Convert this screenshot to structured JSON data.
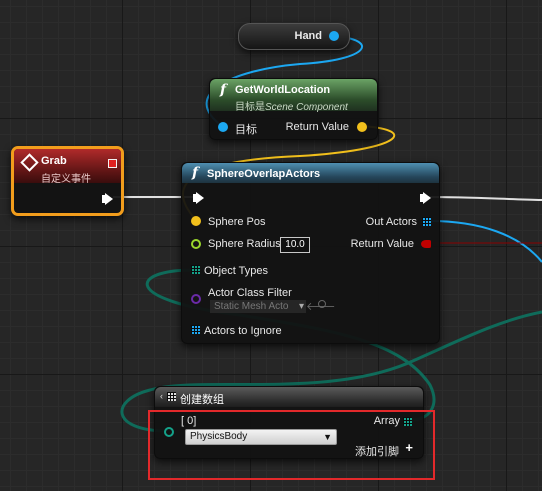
{
  "hand_node": {
    "label": "Hand"
  },
  "get_world_location": {
    "title": "GetWorldLocation",
    "subtitle_prefix": "目标是",
    "subtitle_class": "Scene Component",
    "in_pin": "目标",
    "out_pin": "Return Value"
  },
  "grab_event": {
    "title": "Grab",
    "subtitle": "自定义事件"
  },
  "sphere_overlap": {
    "title": "SphereOverlapActors",
    "pin_sphere_pos": "Sphere Pos",
    "pin_sphere_radius": "Sphere Radius",
    "sphere_radius_value": "10.0",
    "pin_object_types": "Object Types",
    "pin_actor_class_filter": "Actor Class Filter",
    "actor_class_filter_value": "Static Mesh Acto",
    "pin_actors_to_ignore": "Actors to Ignore",
    "out_actors": "Out Actors",
    "return_value": "Return Value"
  },
  "make_array": {
    "title": "创建数组",
    "index_label": "[ 0]",
    "dropdown_value": "PhysicsBody",
    "out_array": "Array",
    "add_pin": "添加引脚"
  },
  "colors": {
    "vector_pin": "#f2c01c",
    "object_pin": "#1ca8f2",
    "bool_pin": "#c00000",
    "float_pin": "#9ad72c",
    "class_pin": "#6a2aa8",
    "enum_pin": "#0f6b5a",
    "selection_highlight": "#e3292b",
    "grab_border": "#f29d1c"
  }
}
